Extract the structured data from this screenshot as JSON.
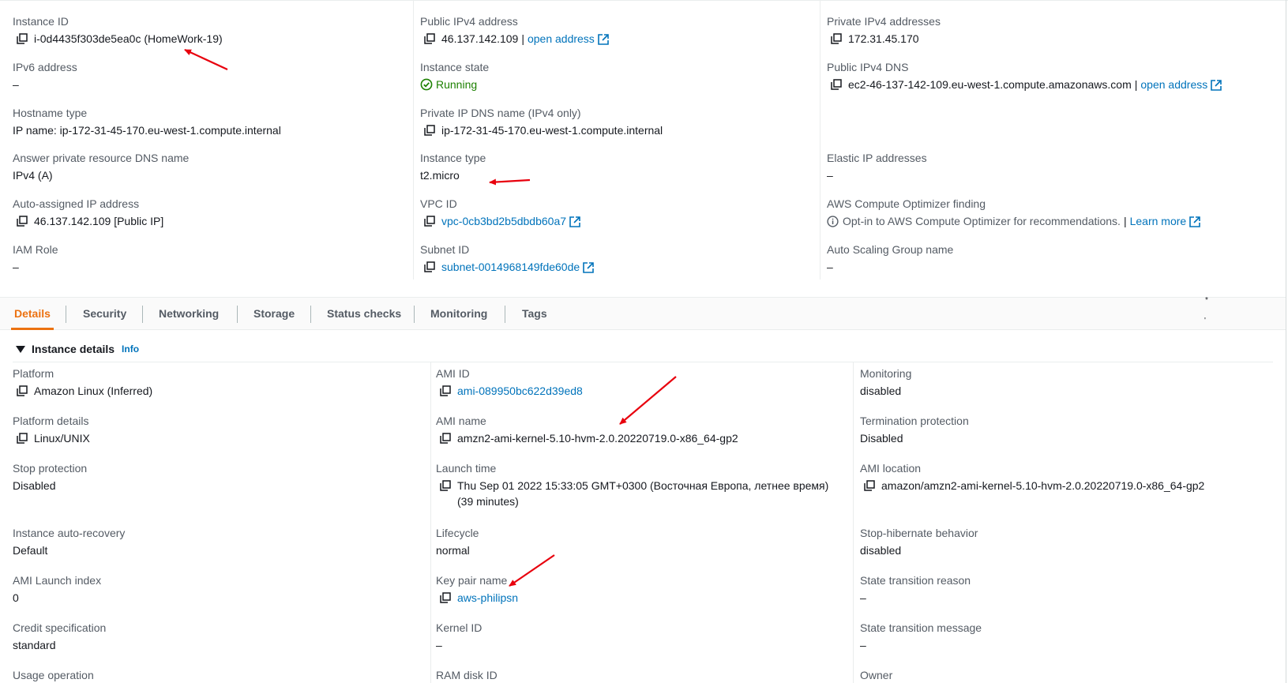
{
  "summary": {
    "instance_id": {
      "label": "Instance ID",
      "value": "i-0d4435f303de5ea0c (HomeWork-19)"
    },
    "public_ipv4": {
      "label": "Public IPv4 address",
      "value": "46.137.142.109",
      "sep": "|",
      "link": "open address"
    },
    "private_ipv4": {
      "label": "Private IPv4 addresses",
      "value": "172.31.45.170"
    },
    "ipv6": {
      "label": "IPv6 address",
      "value": "–"
    },
    "instance_state": {
      "label": "Instance state",
      "value": "Running"
    },
    "public_dns": {
      "label": "Public IPv4 DNS",
      "value": "ec2-46-137-142-109.eu-west-1.compute.amazonaws.com",
      "sep": "|",
      "link": "open address"
    },
    "hostname_type": {
      "label": "Hostname type",
      "value": "IP name: ip-172-31-45-170.eu-west-1.compute.internal"
    },
    "private_dns": {
      "label": "Private IP DNS name (IPv4 only)",
      "value": "ip-172-31-45-170.eu-west-1.compute.internal"
    },
    "answer_dns": {
      "label": "Answer private resource DNS name",
      "value": "IPv4 (A)"
    },
    "instance_type": {
      "label": "Instance type",
      "value": "t2.micro"
    },
    "elastic_ip": {
      "label": "Elastic IP addresses",
      "value": "–"
    },
    "auto_ip": {
      "label": "Auto-assigned IP address",
      "value": "46.137.142.109 [Public IP]"
    },
    "vpc_id": {
      "label": "VPC ID",
      "value": "vpc-0cb3bd2b5dbdb60a7"
    },
    "optimizer": {
      "label": "AWS Compute Optimizer finding",
      "value": "Opt-in to AWS Compute Optimizer for recommendations.",
      "sep": "|",
      "link": "Learn more"
    },
    "iam_role": {
      "label": "IAM Role",
      "value": "–"
    },
    "subnet_id": {
      "label": "Subnet ID",
      "value": "subnet-0014968149fde60de"
    },
    "asg_name": {
      "label": "Auto Scaling Group name",
      "value": "–"
    }
  },
  "tabs": [
    "Details",
    "Security",
    "Networking",
    "Storage",
    "Status checks",
    "Monitoring",
    "Tags"
  ],
  "active_tab": "Details",
  "tab_bar_marks": {
    "top": "*",
    "bottom": "'"
  },
  "details": {
    "title": "Instance details",
    "info": "Info",
    "platform": {
      "label": "Platform",
      "value": "Amazon Linux (Inferred)"
    },
    "ami_id": {
      "label": "AMI ID",
      "value": "ami-089950bc622d39ed8"
    },
    "monitoring": {
      "label": "Monitoring",
      "value": "disabled"
    },
    "platform_details": {
      "label": "Platform details",
      "value": "Linux/UNIX"
    },
    "ami_name": {
      "label": "AMI name",
      "value": "amzn2-ami-kernel-5.10-hvm-2.0.20220719.0-x86_64-gp2"
    },
    "termination": {
      "label": "Termination protection",
      "value": "Disabled"
    },
    "stop_protection": {
      "label": "Stop protection",
      "value": "Disabled"
    },
    "launch_time": {
      "label": "Launch time",
      "value": "Thu Sep 01 2022 15:33:05 GMT+0300 (Восточная Европа, летнее время) (39 minutes)"
    },
    "ami_location": {
      "label": "AMI location",
      "value": "amazon/amzn2-ami-kernel-5.10-hvm-2.0.20220719.0-x86_64-gp2"
    },
    "auto_recovery": {
      "label": "Instance auto-recovery",
      "value": "Default"
    },
    "lifecycle": {
      "label": "Lifecycle",
      "value": "normal"
    },
    "stop_hibernate": {
      "label": "Stop-hibernate behavior",
      "value": "disabled"
    },
    "launch_index": {
      "label": "AMI Launch index",
      "value": "0"
    },
    "key_pair": {
      "label": "Key pair name",
      "value": "aws-philipsn"
    },
    "transition_reason": {
      "label": "State transition reason",
      "value": "–"
    },
    "credit_spec": {
      "label": "Credit specification",
      "value": "standard"
    },
    "kernel_id": {
      "label": "Kernel ID",
      "value": "–"
    },
    "transition_message": {
      "label": "State transition message",
      "value": "–"
    },
    "usage_op": {
      "label": "Usage operation"
    },
    "ramdisk_id": {
      "label": "RAM disk ID"
    },
    "owner": {
      "label": "Owner"
    }
  },
  "colors": {
    "link": "#0073bb",
    "running": "#1d8102",
    "active_tab": "#ec7211",
    "label": "#545b64",
    "annotation_arrow": "#e8000d"
  },
  "icons": [
    "copy-icon",
    "external-link-icon",
    "status-running-icon",
    "info-circle-icon",
    "caret-down-icon"
  ]
}
